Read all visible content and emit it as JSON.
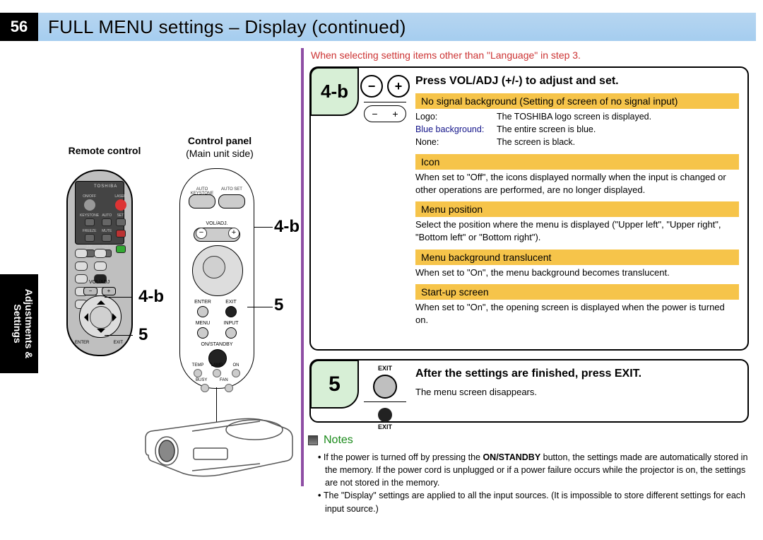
{
  "page_number": "56",
  "title": "FULL MENU settings – Display (continued)",
  "side_tab": "Adjustments & Settings",
  "red_note": "When selecting setting items other than \"Language\" in step 3.",
  "left": {
    "remote_label": "Remote control",
    "cp_label": "Control panel",
    "cp_sub": "(Main unit side)",
    "remote_brand": "TOSHIBA",
    "rl_4b": "4-b",
    "rl_5": "5",
    "pl_4b": "4-b",
    "pl_5": "5",
    "p_auto_keystone": "AUTO KEYSTONE",
    "p_auto_set": "AUTO SET",
    "p_vol": "VOL/ADJ.",
    "p_minus": "−",
    "p_plus": "+",
    "p_enter": "ENTER",
    "p_exit": "EXIT",
    "p_menu": "MENU",
    "p_input": "INPUT",
    "p_standby": "ON/STANDBY",
    "p_temp": "TEMP",
    "p_lamp": "LAMP",
    "p_on": "ON",
    "p_busy": "BUSY",
    "p_fan": "FAN"
  },
  "step4b": {
    "tag": "4-b",
    "minus": "−",
    "plus": "+",
    "pill_minus": "−",
    "pill_plus": "+",
    "title": "Press VOL/ADJ (+/-) to adjust and set.",
    "nosig_hl": "No signal background (Setting of screen of no signal input)",
    "defs": [
      {
        "k": "Logo:",
        "v": "The TOSHIBA logo screen is displayed."
      },
      {
        "k": "Blue background:",
        "v": "The entire screen is blue."
      },
      {
        "k": "None:",
        "v": "The screen is black."
      }
    ],
    "icon_hl": "Icon",
    "icon_desc": "When set to \"Off\", the icons displayed normally when the input is changed or other operations are performed, are no longer displayed.",
    "menupos_hl": "Menu position",
    "menupos_desc": "Select the position where the menu is displayed (\"Upper left\", \"Upper right\", \"Bottom left\" or \"Bottom right\").",
    "menubg_hl": "Menu background translucent",
    "menubg_desc": "When set to \"On\", the menu background becomes translucent.",
    "startup_hl": "Start-up screen",
    "startup_desc": "When set to \"On\", the opening screen is displayed when the power is turned on."
  },
  "step5": {
    "tag": "5",
    "exit1": "EXIT",
    "exit2": "EXIT",
    "title": "After the settings are finished, press EXIT.",
    "desc": "The menu screen disappears."
  },
  "notes": {
    "title": "Notes",
    "n1a": "If the power is turned off by pressing the ",
    "n1b": "ON/STANDBY",
    "n1c": " button, the  settings made are automatically stored in the memory. If the power cord is unplugged or if a power failure occurs while the projector is on, the settings are not stored in the memory.",
    "n2": "The \"Display\" settings are applied to all the input sources. (It is impossible to store different settings for each input source.)"
  }
}
